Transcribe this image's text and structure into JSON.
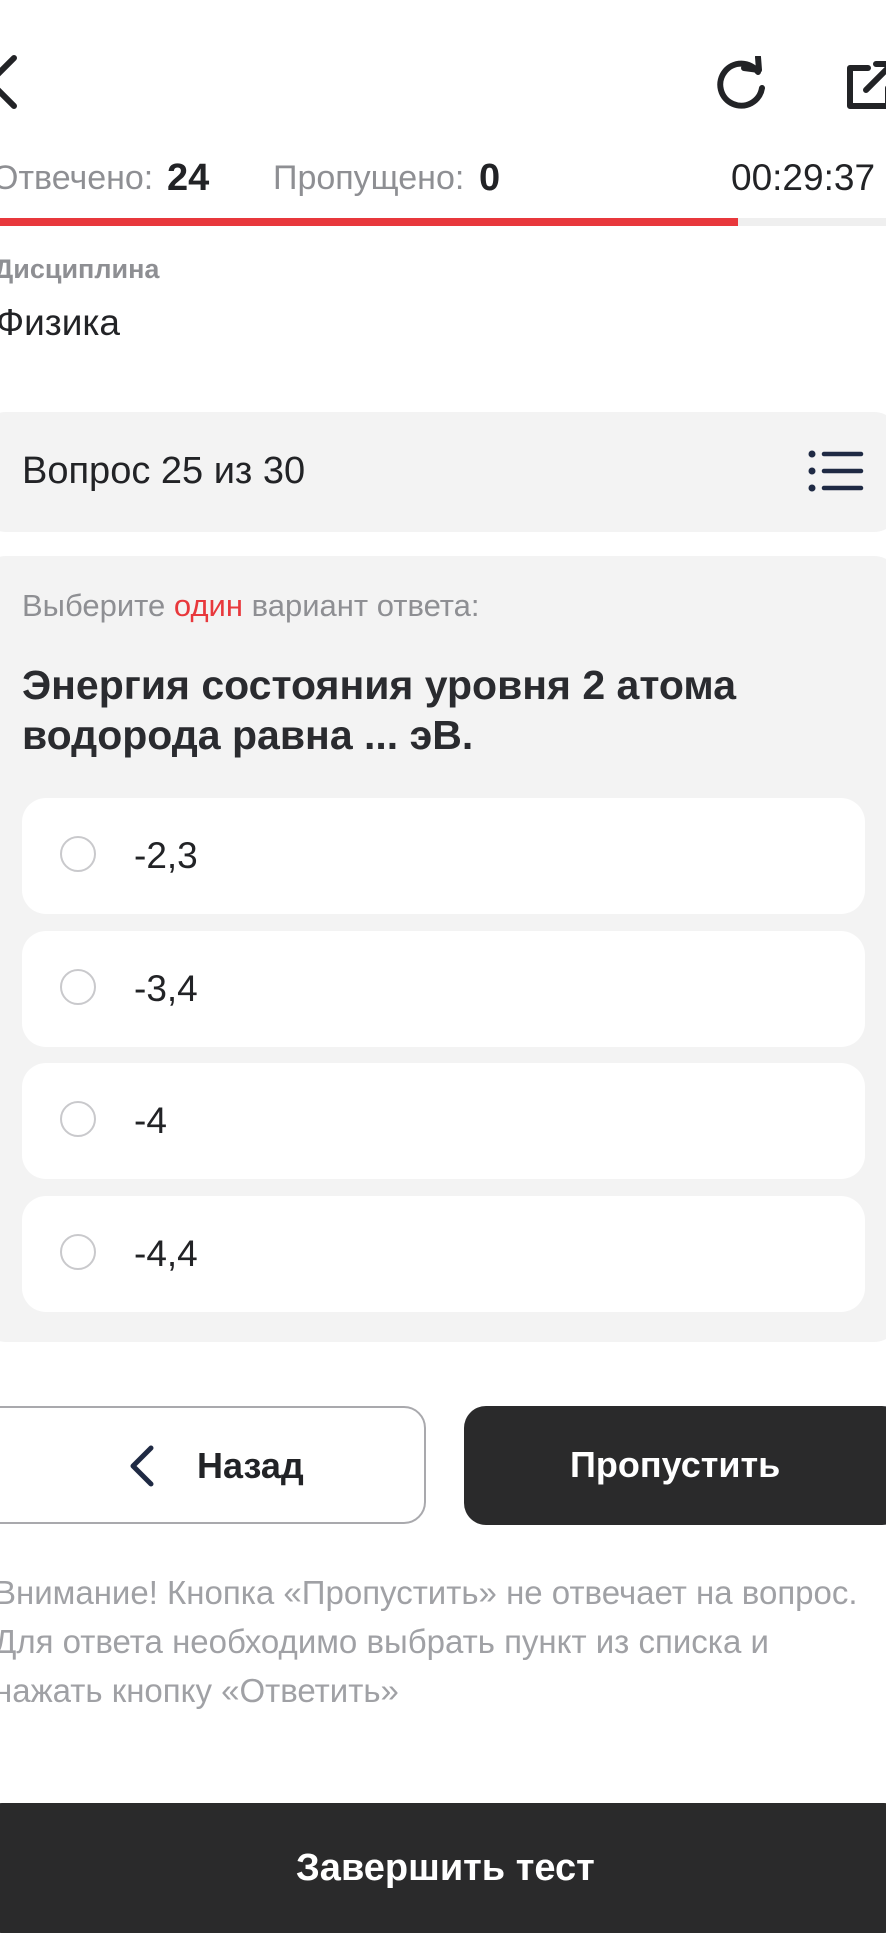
{
  "stats": {
    "answered_label": "Отвечено:",
    "answered_value": "24",
    "skipped_label": "Пропущено:",
    "skipped_value": "0",
    "timer": "00:29:37"
  },
  "progress": {
    "fraction": 0.833
  },
  "discipline": {
    "label": "Дисциплина",
    "value": "Физика"
  },
  "question": {
    "counter": "Вопрос 25 из 30",
    "instruction_prefix": "Выберите",
    "instruction_accent": "один",
    "instruction_suffix": "вариант ответа:",
    "text": "Энергия состояния уровня 2 атома водорода равна ... эВ.",
    "options": [
      "-2,3",
      "-3,4",
      "-4",
      "-4,4"
    ]
  },
  "buttons": {
    "back": "Назад",
    "skip": "Пропустить",
    "finish": "Завершить тест"
  },
  "warning": "Внимание! Кнопка «Пропустить» не отвечает на вопрос. Для ответа необходимо выбрать пункт из списка и нажать кнопку «Ответить»",
  "icons": {
    "back": "chevron-left-icon",
    "reload": "reload-icon",
    "external": "external-link-icon",
    "list": "question-list-icon"
  },
  "colors": {
    "accent": "#e8383c",
    "dark_button": "#2a2a2b",
    "card_background": "#f3f3f3"
  }
}
